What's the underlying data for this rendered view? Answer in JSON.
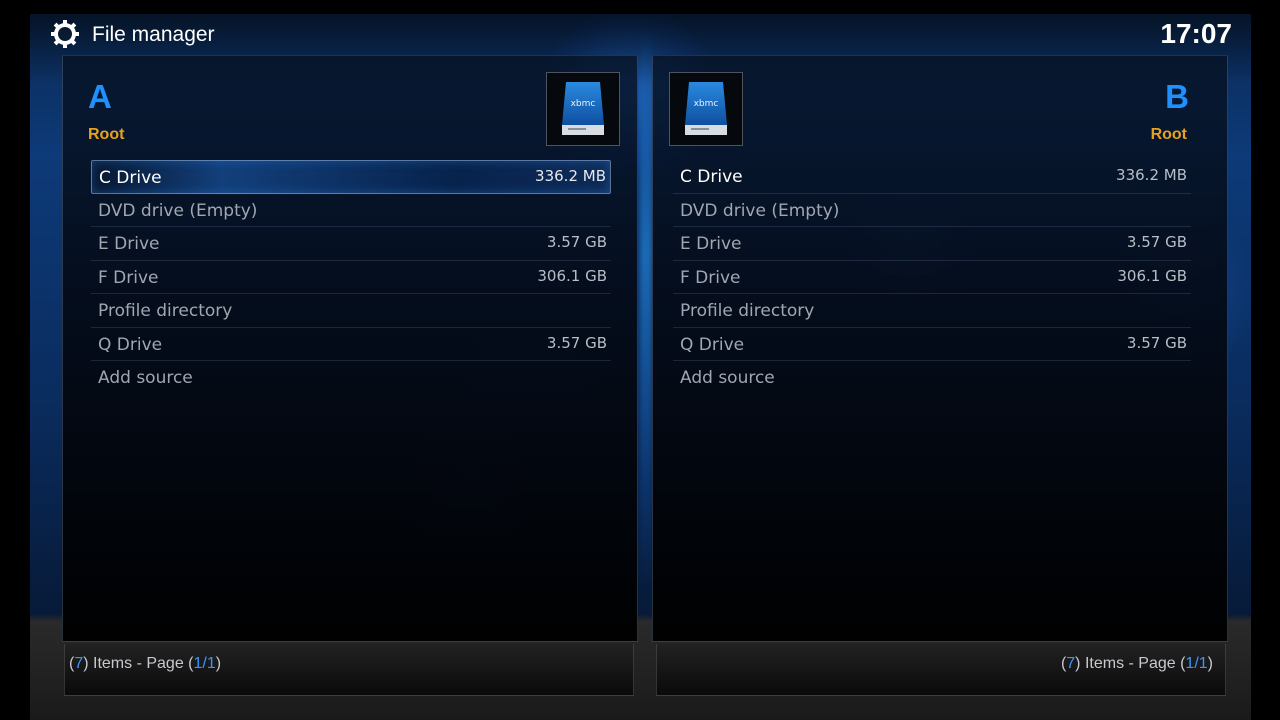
{
  "header": {
    "title": "File manager",
    "clock": "17:07",
    "icon": "gear-icon"
  },
  "colors": {
    "accent": "#1e90ff",
    "root_label": "#e8a020"
  },
  "panel_a": {
    "letter": "A",
    "path": "Root",
    "thumbnail_icon": "drive-icon",
    "items": [
      {
        "name": "C Drive",
        "size": "336.2 MB"
      },
      {
        "name": "DVD drive (Empty)",
        "size": ""
      },
      {
        "name": "E Drive",
        "size": "3.57 GB"
      },
      {
        "name": "F Drive",
        "size": "306.1 GB"
      },
      {
        "name": "Profile directory",
        "size": ""
      },
      {
        "name": "Q Drive",
        "size": "3.57 GB"
      },
      {
        "name": "Add source",
        "size": ""
      }
    ],
    "footer": {
      "open": "(",
      "count": "7",
      "mid": ") Items - Page (",
      "page": "1/1",
      "close": ")"
    }
  },
  "panel_b": {
    "letter": "B",
    "path": "Root",
    "thumbnail_icon": "drive-icon",
    "items": [
      {
        "name": "C Drive",
        "size": "336.2 MB"
      },
      {
        "name": "DVD drive (Empty)",
        "size": ""
      },
      {
        "name": "E Drive",
        "size": "3.57 GB"
      },
      {
        "name": "F Drive",
        "size": "306.1 GB"
      },
      {
        "name": "Profile directory",
        "size": ""
      },
      {
        "name": "Q Drive",
        "size": "3.57 GB"
      },
      {
        "name": "Add source",
        "size": ""
      }
    ],
    "footer": {
      "open": "(",
      "count": "7",
      "mid": ") Items - Page (",
      "page": "1/1",
      "close": ")"
    }
  }
}
